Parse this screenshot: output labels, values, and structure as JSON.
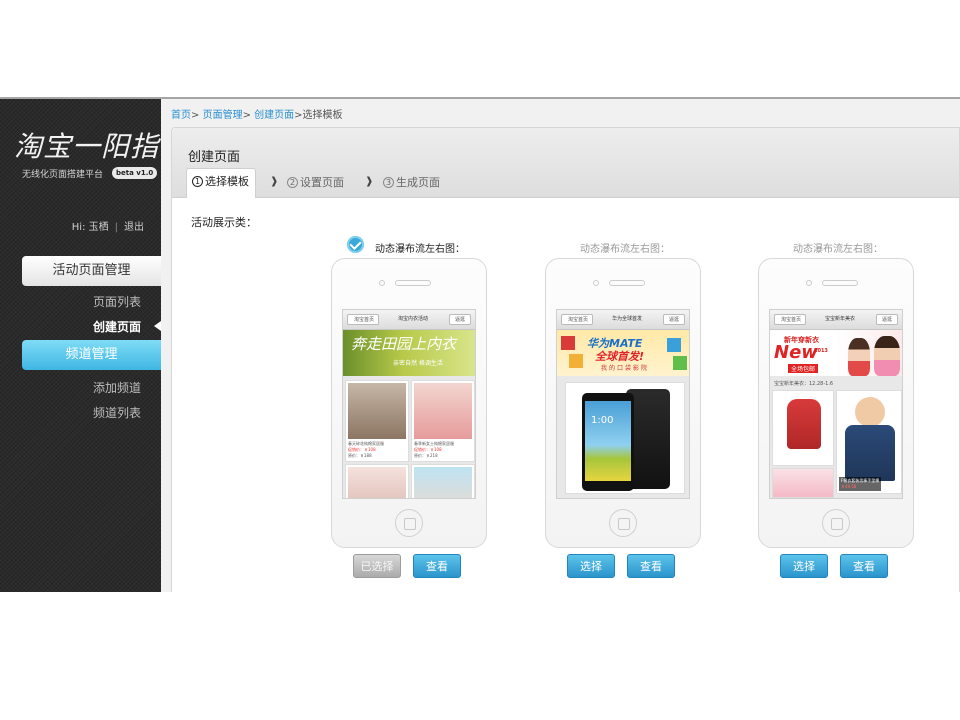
{
  "sidebar": {
    "logo_text": "淘宝一阳指",
    "subtitle": "无线化页面搭建平台",
    "beta": "beta v1.0",
    "greeting": "Hi: 玉栖",
    "logout": "退出",
    "groups": [
      {
        "label": "活动页面管理",
        "items": [
          "页面列表",
          "创建页面"
        ]
      },
      {
        "label": "频道管理",
        "items": [
          "添加频道",
          "频道列表"
        ]
      }
    ]
  },
  "breadcrumb": {
    "home": "首页",
    "page_mgmt": "页面管理",
    "create": "创建页面",
    "current": "选择模板",
    "sep": ">"
  },
  "panel": {
    "title": "创建页面",
    "steps": [
      {
        "num": "1",
        "label": "选择模板"
      },
      {
        "num": "2",
        "label": "设置页面"
      },
      {
        "num": "3",
        "label": "生成页面"
      }
    ],
    "section_label": "活动展示类："
  },
  "templates": [
    {
      "label": "动态瀑布流左右图：",
      "selected": true,
      "screen": {
        "back": "淘宝首页",
        "title": "淘宝内衣活动",
        "btn": "逼逛",
        "banner_big": "奔走田园上内衣",
        "banner_small": "亲密自然 格调生活",
        "items": [
          {
            "name": "春天碎花纯棉家居服",
            "price": "促销价：￥108",
            "orig": "原价：￥188"
          },
          {
            "name": "春季新女士纯棉家居服",
            "price": "促销价：￥108",
            "orig": "原价：￥218"
          }
        ]
      },
      "choose_label": "已选择",
      "view_label": "查看"
    },
    {
      "label": "动态瀑布流左右图：",
      "selected": false,
      "screen": {
        "back": "淘宝首页",
        "title": "华为全球首发",
        "btn": "逼逛",
        "banner_a": "华为MATE",
        "banner_b": "全球首发!",
        "banner_c": "我的口袋影院",
        "phone_time": "1:00"
      },
      "choose_label": "选择",
      "view_label": "查看"
    },
    {
      "label": "动态瀑布流左右图：",
      "selected": false,
      "screen": {
        "back": "淘宝首页",
        "title": "宝宝新年美衣",
        "btn": "逼逛",
        "banner_tag": "新年穿新衣",
        "banner_new": "New",
        "banner_year": "2013",
        "banner_sub": "全场包邮",
        "date_line": "宝宝新年美衣：12.28-1.6",
        "item_text": "F棉衣套装男棒手里棉",
        "item_price": "￥49.58"
      },
      "choose_label": "选择",
      "view_label": "查看"
    }
  ]
}
